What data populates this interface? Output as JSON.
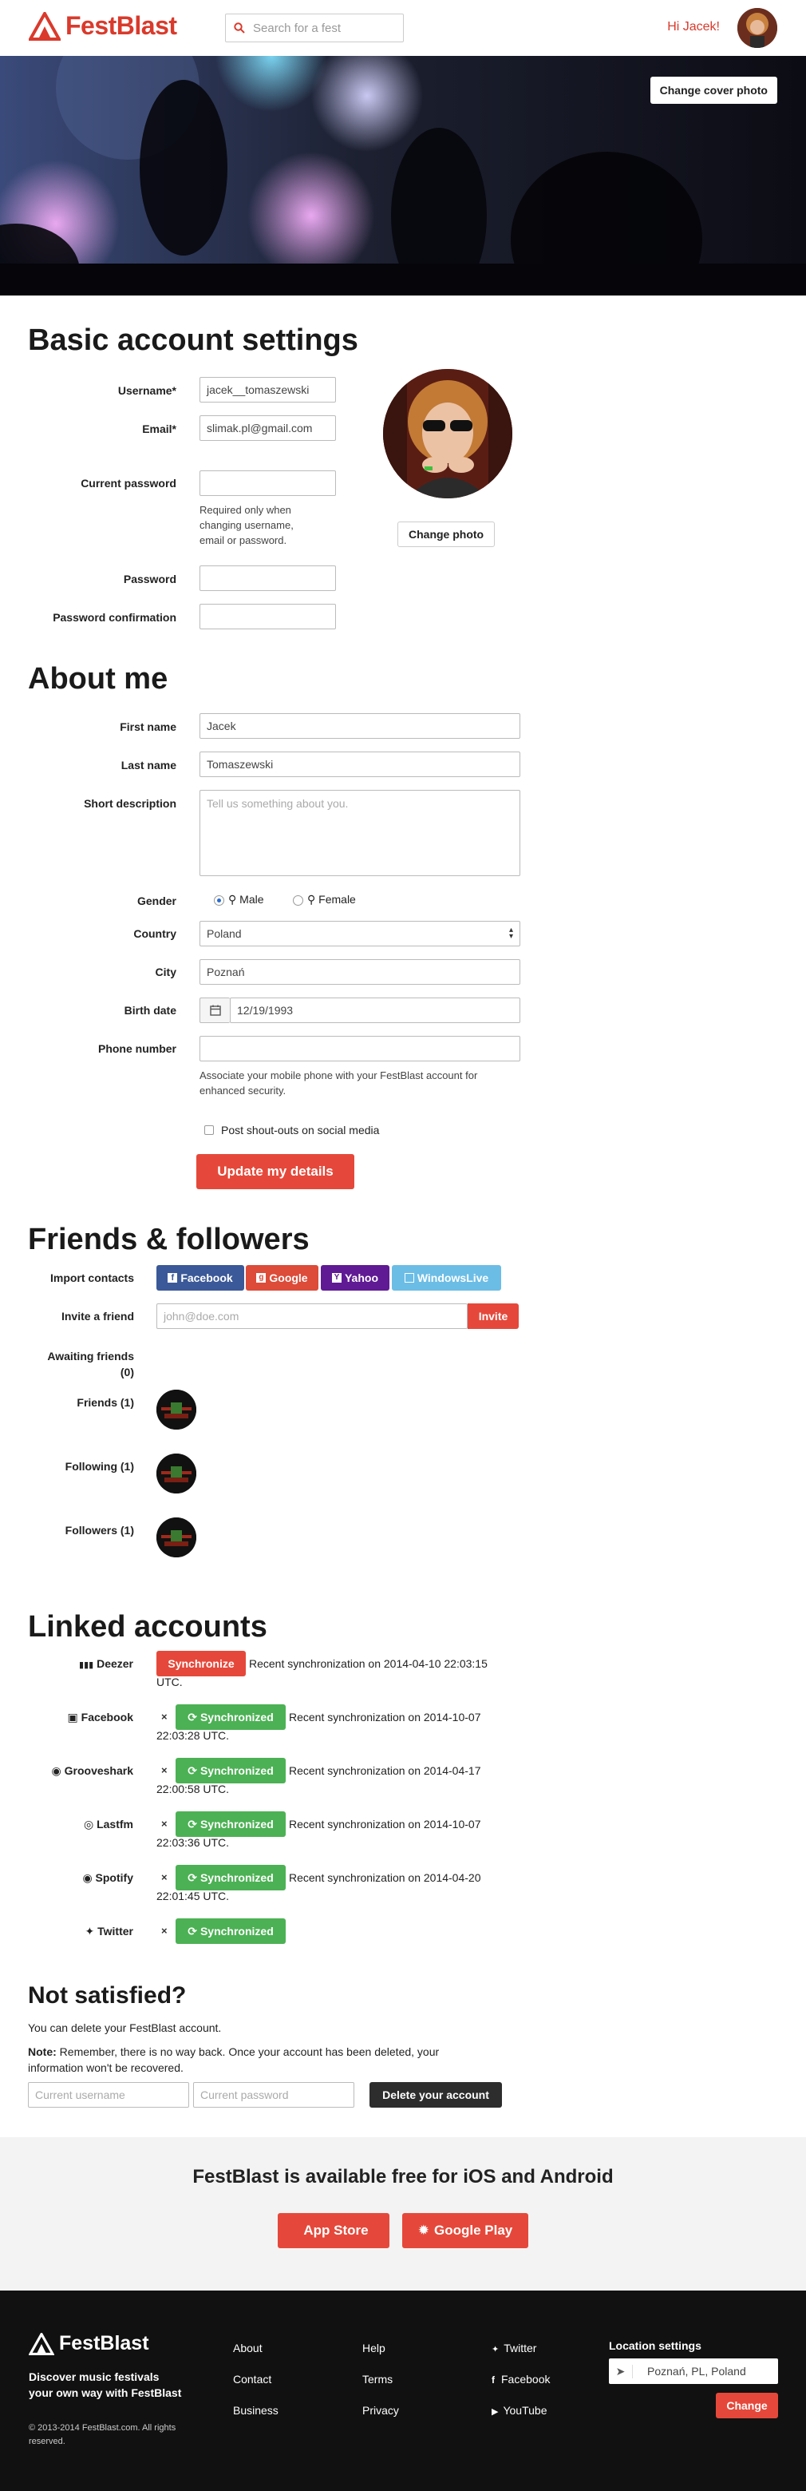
{
  "brand": {
    "name": "FestBlast",
    "color": "#d93a2c"
  },
  "header": {
    "search_placeholder": "Search for a fest",
    "greeting": "Hi",
    "user": "Jacek!"
  },
  "cover": {
    "change_label": "Change cover photo"
  },
  "basic": {
    "title": "Basic account settings",
    "username_label": "Username*",
    "username_value": "jacek__tomaszewski",
    "email_label": "Email*",
    "email_value": "slimak.pl@gmail.com",
    "current_password_label": "Current password",
    "current_password_help": [
      "Required only when",
      "changing username,",
      "email or password."
    ],
    "password_label": "Password",
    "password_confirmation_label": "Password confirmation",
    "change_photo_label": "Change photo"
  },
  "about": {
    "title": "About me",
    "first_name_label": "First name",
    "first_name_value": "Jacek",
    "last_name_label": "Last name",
    "last_name_value": "Tomaszewski",
    "short_desc_label": "Short description",
    "short_desc_placeholder": "Tell us something about you.",
    "gender_label": "Gender",
    "gender_male": "Male",
    "gender_female": "Female",
    "gender_selected": "Male",
    "country_label": "Country",
    "country_value": "Poland",
    "city_label": "City",
    "city_value": "Poznań",
    "birth_label": "Birth date",
    "birth_value": "12/19/1993",
    "phone_label": "Phone number",
    "phone_help": [
      "Associate your mobile phone with your FestBlast account for",
      "enhanced security."
    ],
    "shoutouts_label": "Post shout-outs on social media",
    "update_label": "Update my details"
  },
  "friends": {
    "title": "Friends & followers",
    "import_label": "Import contacts",
    "import_buttons": [
      {
        "label": "Facebook",
        "color": "#3b5998"
      },
      {
        "label": "Google",
        "color": "#dd4b39"
      },
      {
        "label": "Yahoo",
        "color": "#5f1a94"
      },
      {
        "label": "WindowsLive",
        "color": "#6bbde6"
      }
    ],
    "invite_label": "Invite a friend",
    "invite_placeholder": "john@doe.com",
    "invite_button": "Invite",
    "awaiting_label": "Awaiting friends",
    "awaiting_count": "(0)",
    "friends_label": "Friends (1)",
    "following_label": "Following (1)",
    "followers_label": "Followers (1)"
  },
  "linked": {
    "title": "Linked accounts",
    "rows": [
      {
        "service": "Deezer",
        "status": "Synchronize",
        "text1": "Recent synchronization on 2014-04-10 22:03:15",
        "text2": "UTC."
      },
      {
        "service": "Facebook",
        "status": "Synchronized",
        "text1": "Recent synchronization on 2014-10-07",
        "text2": "22:03:28 UTC."
      },
      {
        "service": "Grooveshark",
        "status": "Synchronized",
        "text1": "Recent synchronization on 2014-04-17",
        "text2": "22:00:58 UTC."
      },
      {
        "service": "Lastfm",
        "status": "Synchronized",
        "text1": "Recent synchronization on 2014-10-07",
        "text2": "22:03:36 UTC."
      },
      {
        "service": "Spotify",
        "status": "Synchronized",
        "text1": "Recent synchronization on 2014-04-20",
        "text2": "22:01:45 UTC."
      },
      {
        "service": "Twitter",
        "status": "Synchronized",
        "text1": "",
        "text2": ""
      }
    ],
    "remove_glyph": "×"
  },
  "delete": {
    "title": "Not satisfied?",
    "line1": "You can delete your FestBlast account.",
    "note_bold": "Note:",
    "note_rest": "Remember, there is no way back. Once your account has been deleted, your",
    "note_line2": "information won't be recovered.",
    "username_placeholder": "Current username",
    "password_placeholder": "Current password",
    "button": "Delete your account"
  },
  "promo": {
    "title": "FestBlast is available free for iOS and Android",
    "app_store": "App Store",
    "google_play": "Google Play"
  },
  "footer": {
    "tagline": [
      "Discover music festivals",
      "your own way with FestBlast"
    ],
    "copyright": [
      "© 2013-2014 FestBlast.com. All rights",
      "reserved."
    ],
    "col1": [
      "About",
      "Contact",
      "Business"
    ],
    "col2": [
      "Help",
      "Terms",
      "Privacy"
    ],
    "col3": [
      "Twitter",
      "Facebook",
      "YouTube"
    ],
    "location_title": "Location settings",
    "location_value": "Poznań, PL, Poland",
    "change_button": "Change"
  }
}
